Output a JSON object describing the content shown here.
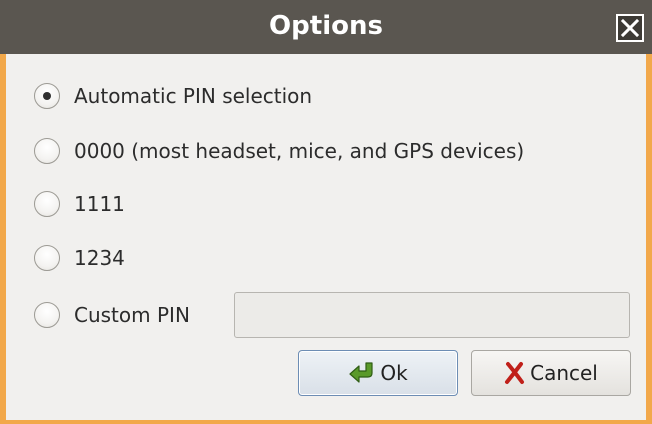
{
  "window": {
    "title": "Options",
    "close_icon": "close-icon"
  },
  "pin_options": [
    {
      "label": "Automatic PIN selection",
      "selected": true
    },
    {
      "label": "0000 (most headset, mice, and GPS devices)",
      "selected": false
    },
    {
      "label": "1111",
      "selected": false
    },
    {
      "label": "1234",
      "selected": false
    },
    {
      "label": "Custom PIN",
      "selected": false
    }
  ],
  "custom_pin": {
    "value": "",
    "placeholder": ""
  },
  "buttons": {
    "ok_label": "Ok",
    "ok_icon": "ok-arrow-icon",
    "cancel_label": "Cancel",
    "cancel_icon": "cancel-x-icon"
  },
  "colors": {
    "titlebar": "#5a5650",
    "window_border": "#f2a84a",
    "content_bg": "#f1f0ee",
    "ok_icon": "#5a9a2a",
    "cancel_icon": "#c0201a"
  }
}
